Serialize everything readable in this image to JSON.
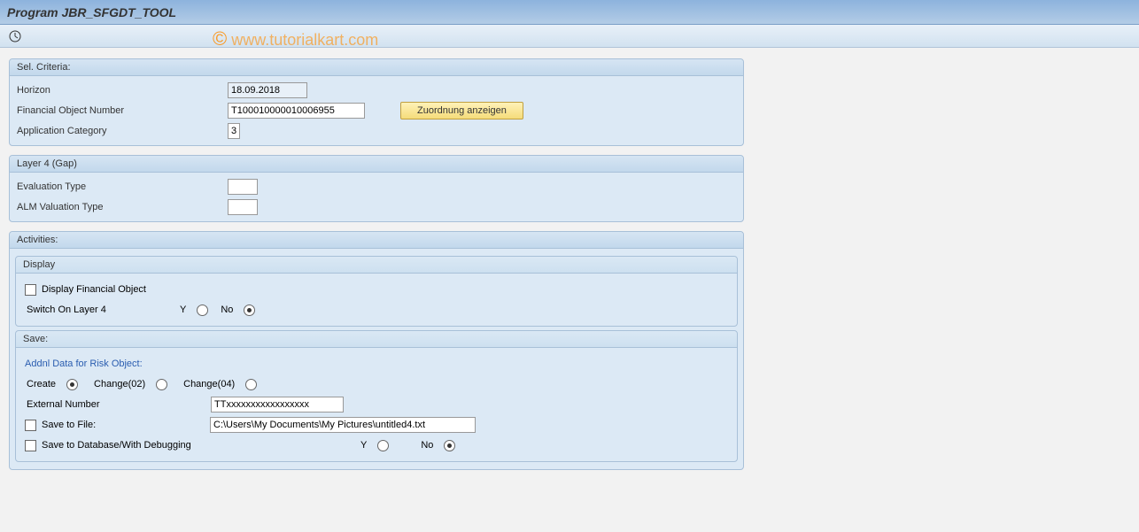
{
  "title": "Program JBR_SFGDT_TOOL",
  "watermark": "© www.tutorialkart.com",
  "selCriteria": {
    "header": "Sel. Criteria:",
    "horizon_label": "Horizon",
    "horizon_value": "18.09.2018",
    "finobj_label": "Financial Object Number",
    "finobj_value": "T100010000010006955",
    "button_label": "Zuordnung anzeigen",
    "appcat_label": "Application Category",
    "appcat_value": "3"
  },
  "layer4": {
    "header": "Layer 4 (Gap)",
    "evaltype_label": "Evaluation Type",
    "evaltype_value": "",
    "almtype_label": "ALM Valuation Type",
    "almtype_value": ""
  },
  "activities": {
    "header": "Activities:",
    "display": {
      "header": "Display",
      "dfo_label": "Display Financial Object",
      "switch_label": "Switch On Layer 4",
      "y_label": "Y",
      "no_label": "No"
    },
    "save": {
      "header": "Save:",
      "addnl_label": "Addnl Data for Risk Object:",
      "create_label": "Create",
      "change02_label": "Change(02)",
      "change04_label": "Change(04)",
      "extnum_label": "External Number",
      "extnum_value": "TTxxxxxxxxxxxxxxxxx",
      "savefile_label": "Save to File:",
      "savefile_value": "C:\\Users\\My Documents\\My Pictures\\untitled4.txt",
      "savedb_label": "Save to Database/With Debugging",
      "y_label": "Y",
      "no_label": "No"
    }
  }
}
